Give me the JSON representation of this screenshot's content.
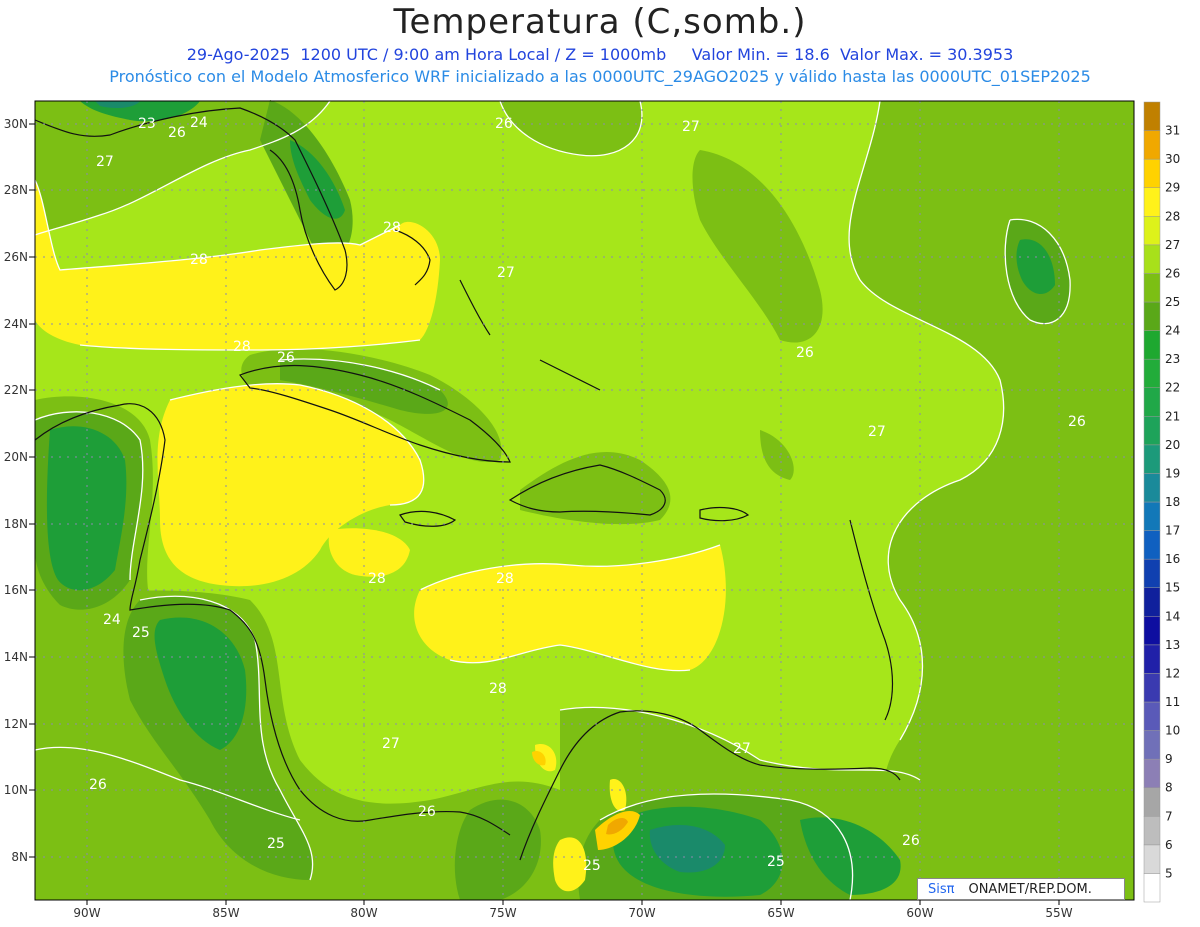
{
  "title": "Temperatura (C,somb.)",
  "subtitle1": "29-Ago-2025  1200 UTC / 9:00 am Hora Local / Z = 1000mb     Valor Min. = 18.6  Valor Max. = 30.3953",
  "subtitle2": "Pronóstico con el Modelo Atmosferico WRF inicializado a las 0000UTC_29AGO2025 y válido hasta las  0000UTC_01SEP2025",
  "credit": {
    "logo": "Sisπ",
    "text": "ONAMET/REP.DOM."
  },
  "axes": {
    "lon_labels": [
      "90W",
      "85W",
      "80W",
      "75W",
      "70W",
      "65W",
      "60W",
      "55W"
    ],
    "lat_labels": [
      "30N",
      "28N",
      "26N",
      "24N",
      "22N",
      "20N",
      "18N",
      "16N",
      "14N",
      "12N",
      "10N",
      "8N"
    ]
  },
  "contour_labels": [
    {
      "text": "23"
    },
    {
      "text": "24"
    },
    {
      "text": "26"
    },
    {
      "text": "27"
    },
    {
      "text": "26"
    },
    {
      "text": "27"
    },
    {
      "text": "28"
    },
    {
      "text": "28"
    },
    {
      "text": "27"
    },
    {
      "text": "28"
    },
    {
      "text": "26"
    },
    {
      "text": "26"
    },
    {
      "text": "27"
    },
    {
      "text": "26"
    },
    {
      "text": "28"
    },
    {
      "text": "28"
    },
    {
      "text": "24"
    },
    {
      "text": "25"
    },
    {
      "text": "28"
    },
    {
      "text": "27"
    },
    {
      "text": "27"
    },
    {
      "text": "26"
    },
    {
      "text": "26"
    },
    {
      "text": "25"
    },
    {
      "text": "25"
    },
    {
      "text": "25"
    },
    {
      "text": "26"
    }
  ],
  "legend": {
    "levels": [
      "5",
      "6",
      "7",
      "8",
      "9",
      "10",
      "11",
      "12",
      "13",
      "14",
      "15",
      "16",
      "17",
      "18",
      "19",
      "20",
      "21",
      "22",
      "23",
      "24",
      "25",
      "26",
      "27",
      "28",
      "29",
      "30",
      "31"
    ],
    "colors": [
      "#ffffff",
      "#d9d9d9",
      "#bdbdbd",
      "#a6a6a6",
      "#8c7fb5",
      "#7070b8",
      "#5a5ab8",
      "#3a3ab0",
      "#2020a8",
      "#0e0ea0",
      "#10209c",
      "#1040b0",
      "#1060c0",
      "#1278b8",
      "#1a8a9a",
      "#1c9a7a",
      "#1ea35a",
      "#20a848",
      "#22ac3a",
      "#1ea830",
      "#5aa818",
      "#7cbf14",
      "#a8e01a",
      "#ddf21a",
      "#fff21a",
      "#ffd200",
      "#f0a800",
      "#c08000"
    ]
  },
  "colors": {
    "t24": "#1e9e38",
    "t25": "#5aa818",
    "t26": "#7cbf14",
    "t27": "#a6e61a",
    "t28": "#fff21a",
    "t29": "#ffd200",
    "t30": "#f0a800"
  }
}
